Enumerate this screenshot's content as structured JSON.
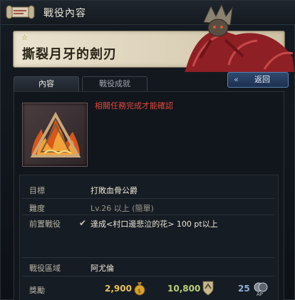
{
  "window": {
    "title": "戰役內容"
  },
  "banner": {
    "title": "撕裂月牙的劍刃"
  },
  "tabs": [
    {
      "label": "內容"
    },
    {
      "label": "戰役成就"
    }
  ],
  "back_button": {
    "arrow": "«",
    "label": "返回"
  },
  "notice": "相關任務完成才能確認",
  "details": {
    "target_label": "目標",
    "target_value": "打敗血骨公爵",
    "difficulty_label": "難度",
    "difficulty_value": "Lv.26 以上 (簡單)",
    "prereq_label": "前置戰役",
    "prereq_value": "達成<村口邊悲泣的花> 100 pt以上",
    "area_label": "戰役區域",
    "area_value": "阿尤倫",
    "reward_label": "獎勵"
  },
  "rewards": {
    "gold": "2,900",
    "contribution": "10,800",
    "ap": "25"
  },
  "icons": [
    "scroll-icon",
    "quest-fire-icon",
    "check-icon",
    "money-bag-icon",
    "shield-badge-icon",
    "ap-icon"
  ],
  "colors": {
    "notice": "#e0483c",
    "gold": "#e8c25a",
    "green": "#b9d27a",
    "blue": "#8fb0d8"
  }
}
